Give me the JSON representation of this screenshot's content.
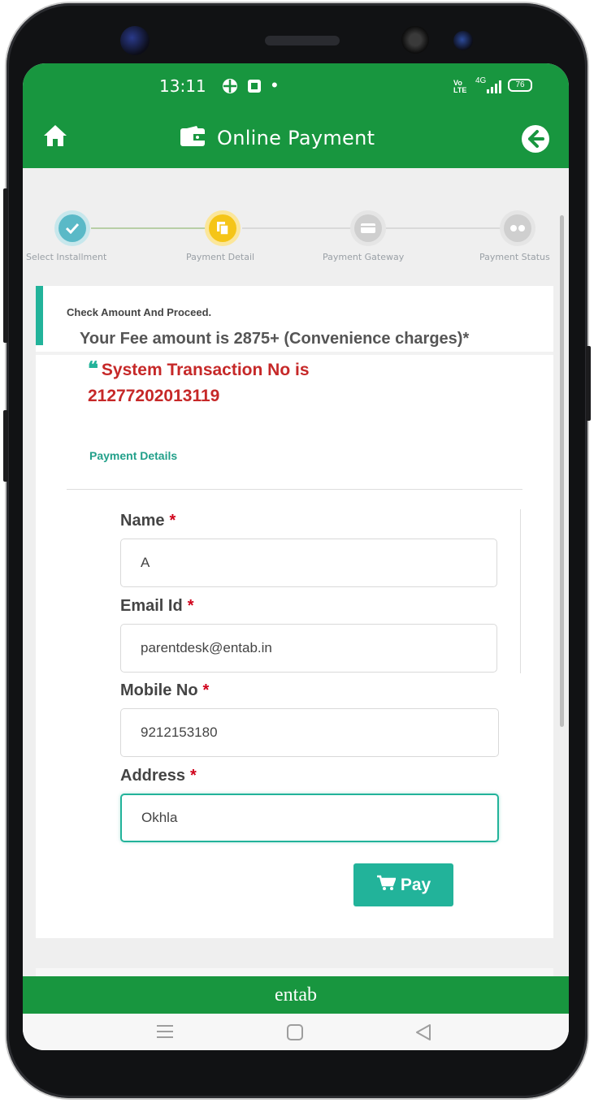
{
  "statusbar": {
    "time": "13:11",
    "dot": "•",
    "battery": "76",
    "network": "4G",
    "volte": "Vo LTE"
  },
  "appbar": {
    "title": "Online Payment",
    "home_icon": "home-icon",
    "payment_icon": "wallet-icon",
    "back_icon": "back-arrow-icon"
  },
  "stepper": {
    "steps": [
      {
        "label": "Select Installment",
        "state": "done"
      },
      {
        "label": "Payment Detail",
        "state": "active"
      },
      {
        "label": "Payment Gateway",
        "state": "pending"
      },
      {
        "label": "Payment Status",
        "state": "pending"
      }
    ],
    "colors": {
      "done": "#5ab9c7",
      "active": "#f5c518",
      "pending": "#cfcfcf"
    }
  },
  "notice": {
    "heading": "Check Amount And Proceed.",
    "fee_text": "Your Fee amount is 2875+ (Convenience charges)*"
  },
  "transaction": {
    "icon": "quote-icon",
    "text": "System Transaction No is 21277202013119"
  },
  "section": {
    "title": "Payment Details"
  },
  "form": {
    "required_mark": "*",
    "name_label": "Name",
    "name_value": "A",
    "email_label": "Email Id",
    "email_value": "parentdesk@entab.in",
    "mobile_label": "Mobile No",
    "mobile_value": "9212153180",
    "address_label": "Address",
    "address_value": "Okhla",
    "pay_label": "Pay"
  },
  "footer": {
    "brand": "entab"
  },
  "colors": {
    "brand_green": "#18963f",
    "teal": "#22b39a",
    "error_red": "#c62828"
  }
}
